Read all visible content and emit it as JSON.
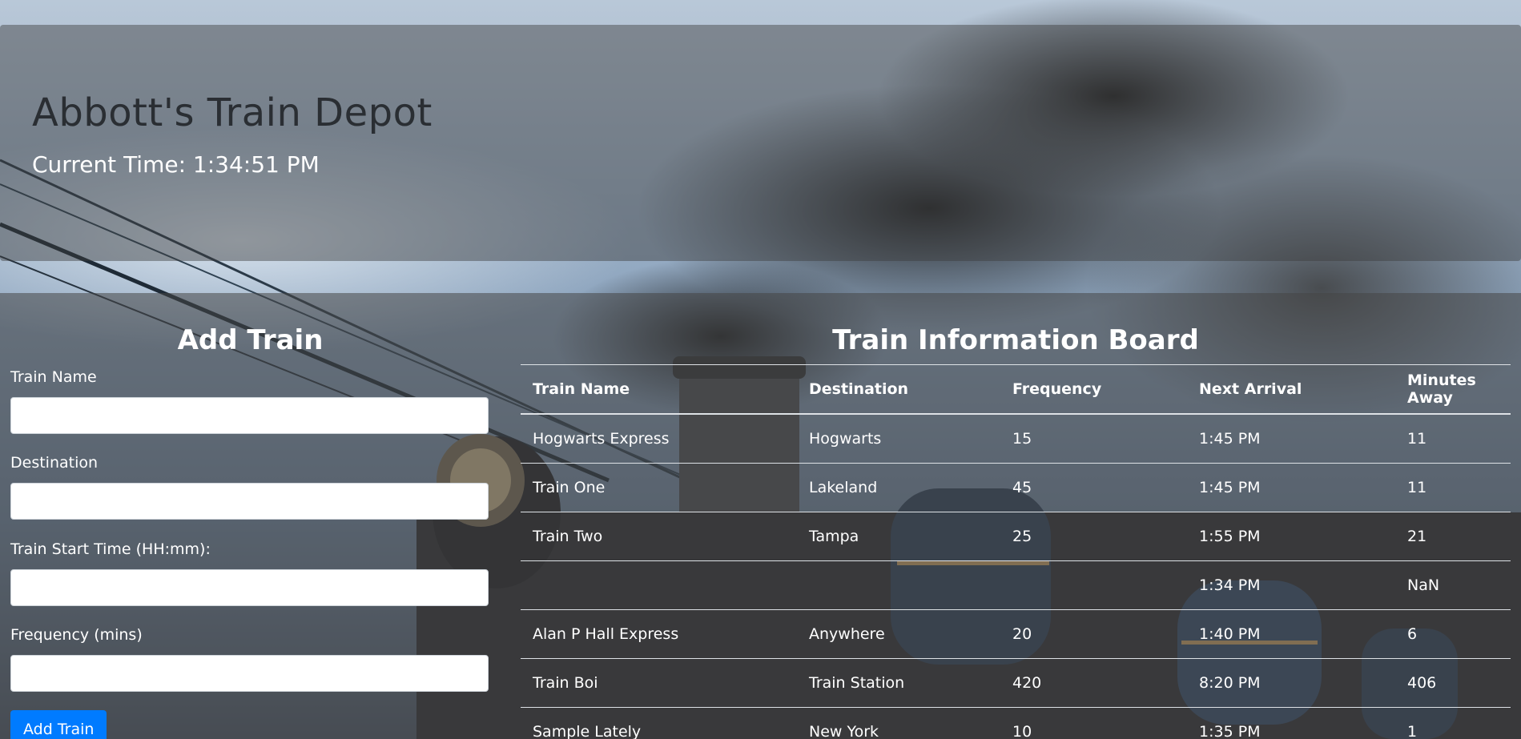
{
  "header": {
    "title": "Abbott's Train Depot",
    "current_time_prefix": "Current Time: ",
    "current_time": "1:34:51 PM"
  },
  "form": {
    "heading": "Add Train",
    "fields": [
      {
        "label": "Train Name",
        "value": "",
        "placeholder": ""
      },
      {
        "label": "Destination",
        "value": "",
        "placeholder": ""
      },
      {
        "label": "Train Start Time (HH:mm):",
        "value": "",
        "placeholder": ""
      },
      {
        "label": "Frequency (mins)",
        "value": "",
        "placeholder": ""
      }
    ],
    "submit_label": "Add Train"
  },
  "board": {
    "heading": "Train Information Board",
    "columns": [
      "Train Name",
      "Destination",
      "Frequency",
      "Next Arrival",
      "Minutes Away"
    ],
    "rows": [
      [
        "Hogwarts Express",
        "Hogwarts",
        "15",
        "1:45 PM",
        "11"
      ],
      [
        "Train One",
        "Lakeland",
        "45",
        "1:45 PM",
        "11"
      ],
      [
        "Train Two",
        "Tampa",
        "25",
        "1:55 PM",
        "21"
      ],
      [
        "",
        "",
        "",
        "1:34 PM",
        "NaN"
      ],
      [
        "Alan P Hall Express",
        "Anywhere",
        "20",
        "1:40 PM",
        "6"
      ],
      [
        "Train Boi",
        "Train Station",
        "420",
        "8:20 PM",
        "406"
      ],
      [
        "Sample Lately",
        "New York",
        "10",
        "1:35 PM",
        "1"
      ]
    ]
  },
  "colors": {
    "button": "#007bff",
    "title_text": "#2a2e33",
    "text": "#ffffff"
  }
}
